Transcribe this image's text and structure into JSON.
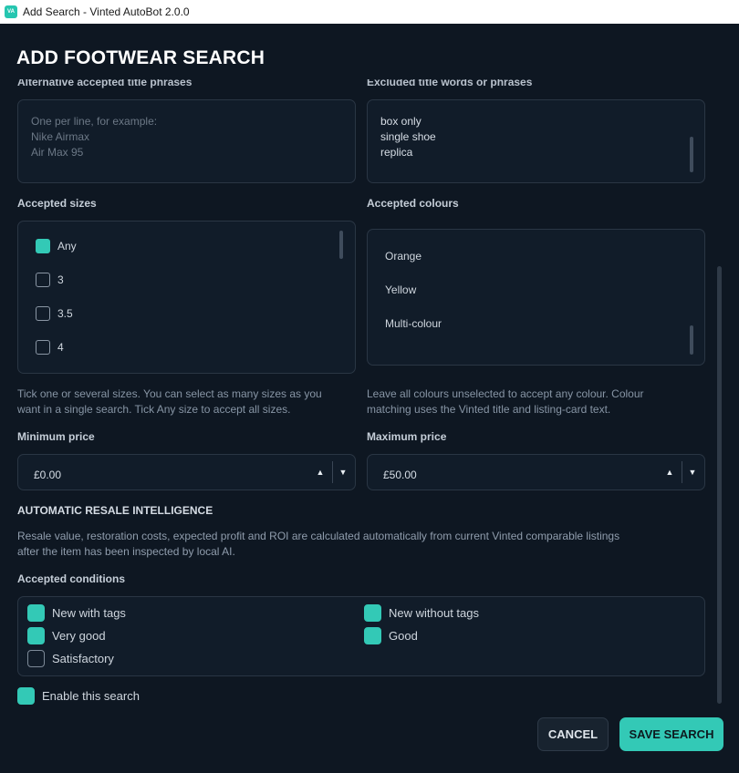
{
  "window": {
    "title": "Add Search - Vinted AutoBot 2.0.0",
    "icon_text": "VA",
    "icon_color": "#26c6b0"
  },
  "page_title": "ADD FOOTWEAR SEARCH",
  "alt_phrases": {
    "label": "Alternative accepted title phrases",
    "placeholder": "One per line, for example:\nNike Airmax\nAir Max 95"
  },
  "excluded": {
    "label": "Excluded title words or phrases",
    "value": "box only\nsingle shoe\nreplica"
  },
  "sizes": {
    "label": "Accepted sizes",
    "options": [
      {
        "label": "Any",
        "checked": true
      },
      {
        "label": "3",
        "checked": false
      },
      {
        "label": "3.5",
        "checked": false
      },
      {
        "label": "4",
        "checked": false
      }
    ],
    "help": "Tick one or several sizes. You can select as many sizes as you\nwant in a single search. Tick Any size to accept all sizes."
  },
  "colours": {
    "label": "Accepted colours",
    "options": [
      "Orange",
      "Yellow",
      "Multi-colour"
    ],
    "help": "Leave all colours unselected to accept any colour. Colour\nmatching uses the Vinted title and listing-card text."
  },
  "min_price": {
    "label": "Minimum price",
    "value": "£0.00"
  },
  "max_price": {
    "label": "Maximum price",
    "value": "£50.00"
  },
  "resale": {
    "heading": "AUTOMATIC RESALE INTELLIGENCE",
    "text": "Resale value, restoration costs, expected profit and ROI are calculated automatically from current Vinted comparable listings\nafter the item has been inspected by local AI."
  },
  "conditions": {
    "label": "Accepted conditions",
    "options": [
      {
        "label": "New with tags",
        "checked": true
      },
      {
        "label": "New without tags",
        "checked": true
      },
      {
        "label": "Very good",
        "checked": true
      },
      {
        "label": "Good",
        "checked": true
      },
      {
        "label": "Satisfactory",
        "checked": false
      }
    ]
  },
  "enable": {
    "label": "Enable this search",
    "checked": true
  },
  "buttons": {
    "cancel": "CANCEL",
    "save": "SAVE SEARCH"
  },
  "icons": {
    "up": "spin-up-icon",
    "down": "spin-down-icon"
  },
  "colors": {
    "accent": "#33c9b6",
    "background": "#0e1722"
  }
}
